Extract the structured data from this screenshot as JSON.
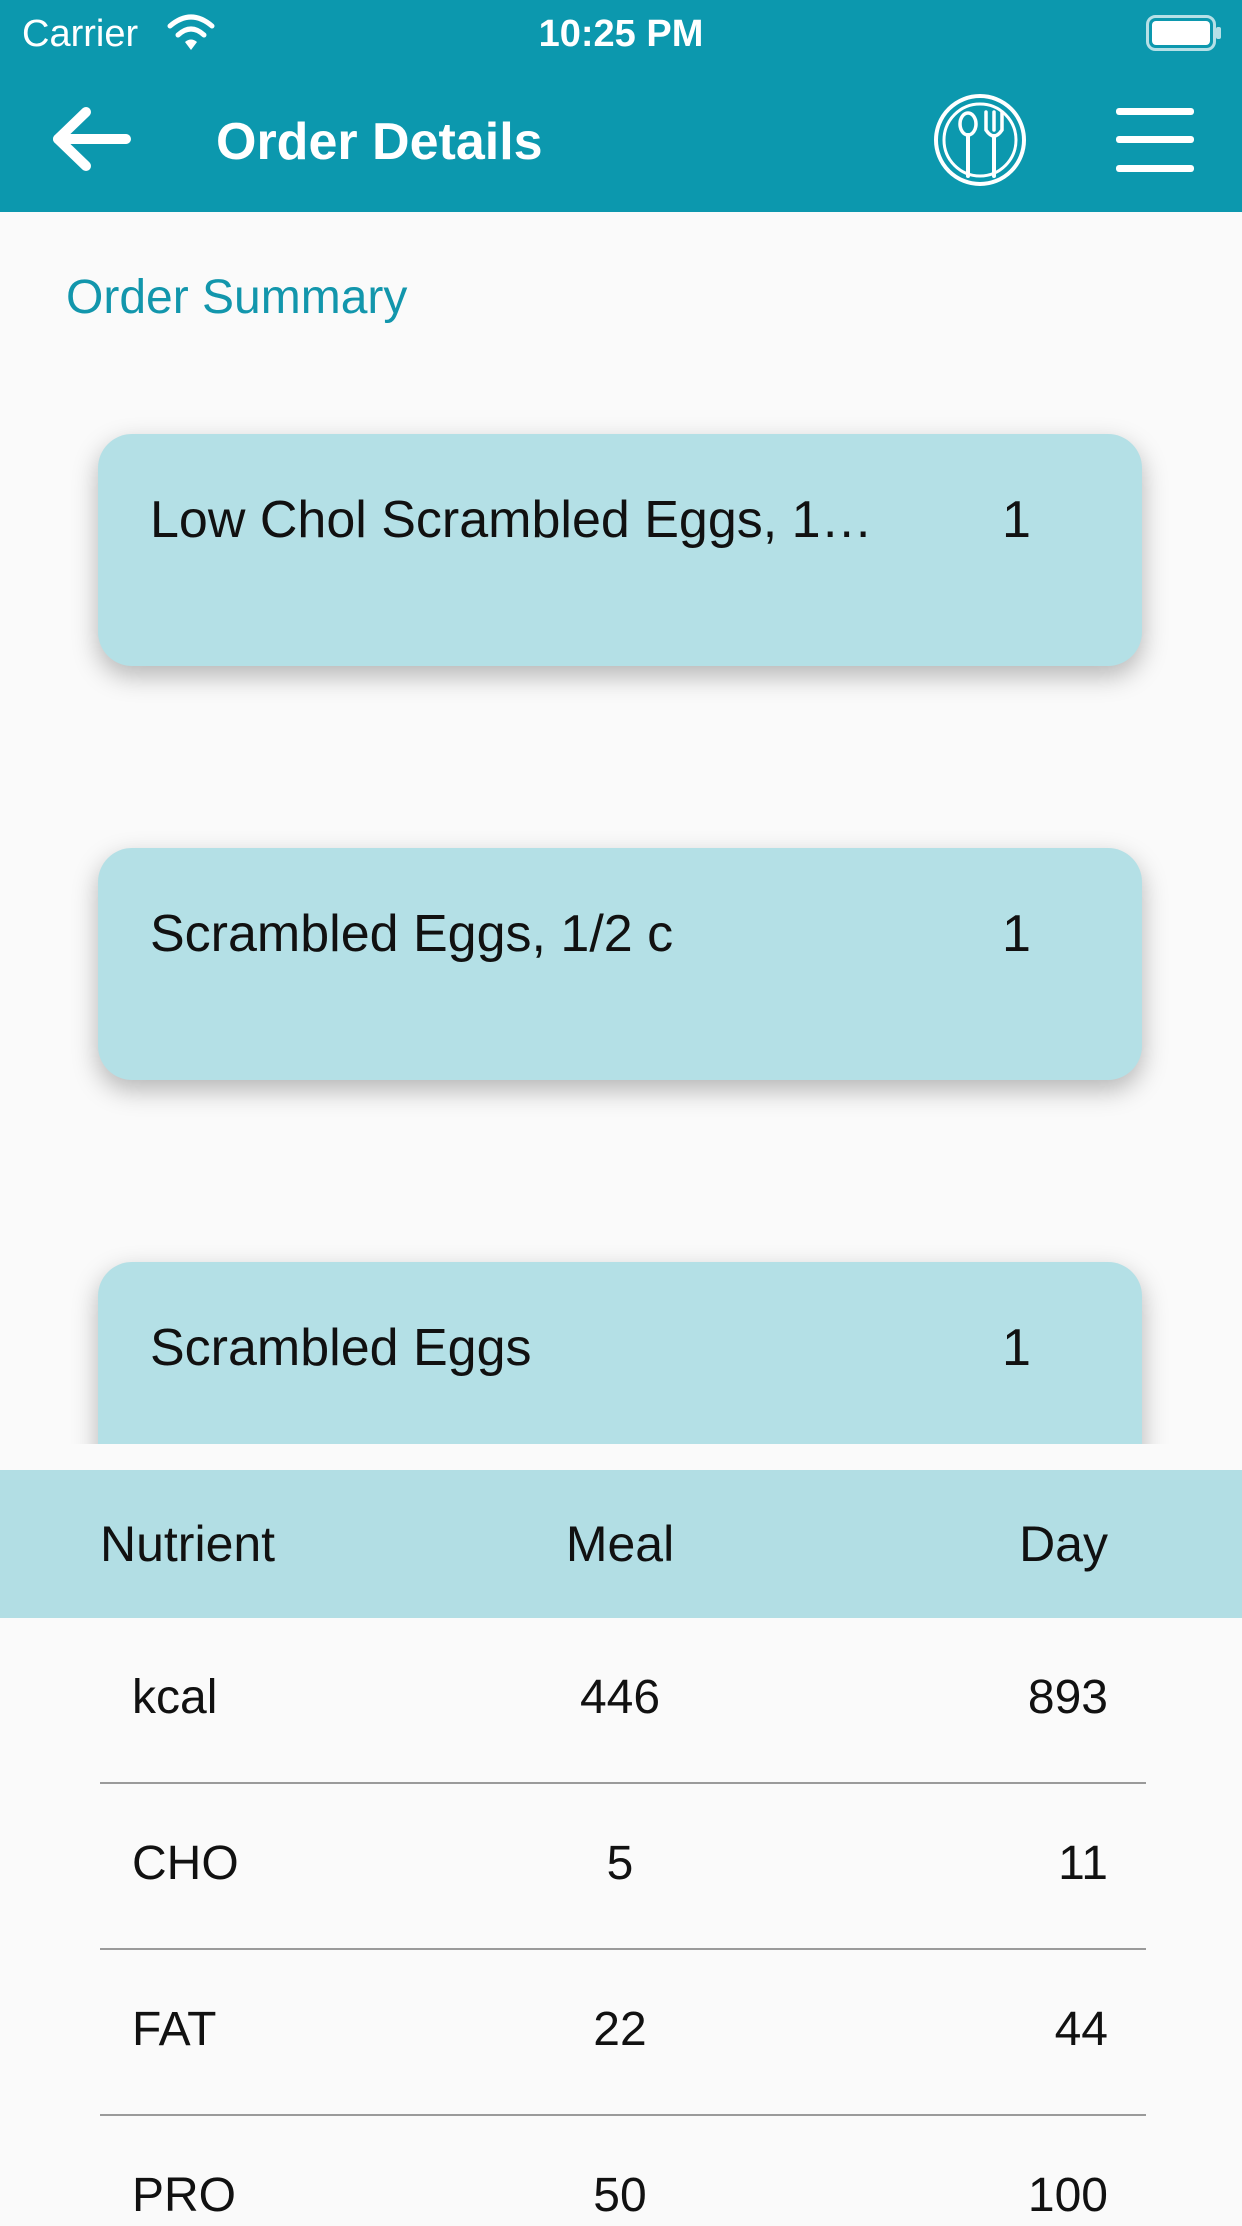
{
  "status_bar": {
    "carrier": "Carrier",
    "time": "10:25 PM",
    "wifi_icon": "wifi-icon",
    "battery_icon": "battery-icon"
  },
  "nav_bar": {
    "title": "Order Details",
    "back_icon": "arrow-left-icon",
    "dining_icon": "spoon-fork-plate-icon",
    "menu_icon": "hamburger-menu-icon"
  },
  "order_summary": {
    "title": "Order Summary",
    "items": [
      {
        "name": "Low Chol Scrambled Eggs, 1…",
        "quantity": "1"
      },
      {
        "name": "Scrambled Eggs, 1/2 c",
        "quantity": "1"
      },
      {
        "name": "Scrambled Eggs",
        "quantity": "1"
      }
    ]
  },
  "nutrients": {
    "headers": {
      "nutrient": "Nutrient",
      "meal": "Meal",
      "day": "Day"
    },
    "rows": [
      {
        "name": "kcal",
        "meal": "446",
        "day": "893"
      },
      {
        "name": "CHO",
        "meal": "5",
        "day": "11"
      },
      {
        "name": "FAT",
        "meal": "22",
        "day": "44"
      },
      {
        "name": "PRO",
        "meal": "50",
        "day": "100"
      }
    ]
  },
  "colors": {
    "primary": "#0c98ae",
    "card": "#b4e0e6",
    "header_row": "#b2dee4",
    "accent_text": "#1296ac",
    "background": "#fafafa"
  }
}
